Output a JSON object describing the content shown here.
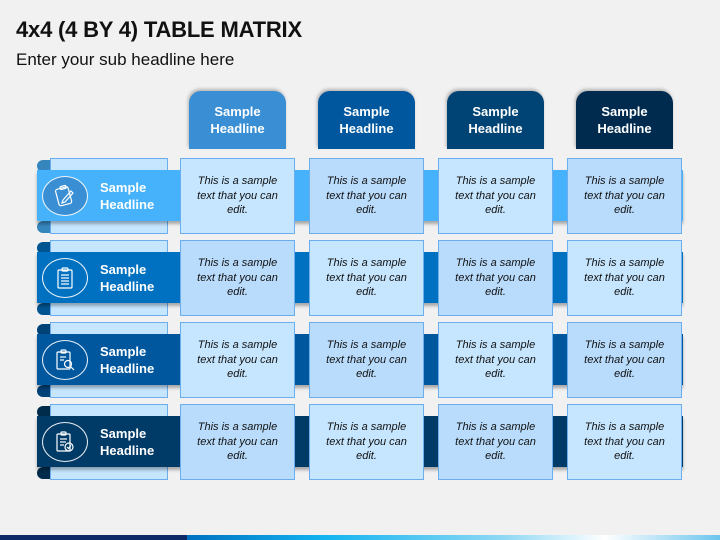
{
  "title": "4x4 (4 BY 4) TABLE MATRIX",
  "subtitle": "Enter your sub headline here",
  "colors": {
    "col_headers": [
      "#3a8fd4",
      "#00579e",
      "#004475",
      "#002b4f"
    ],
    "rows": [
      "#46b2fb",
      "#0070c0",
      "#00579e",
      "#003a66"
    ],
    "cell_light": "#c6e6ff",
    "cell_alt": "#b9dcfc",
    "cell_border": "#6aaef0"
  },
  "columns": [
    {
      "label": "Sample Headline"
    },
    {
      "label": "Sample Headline"
    },
    {
      "label": "Sample Headline"
    },
    {
      "label": "Sample Headline"
    }
  ],
  "rows": [
    {
      "label": "Sample Headline",
      "icon": "clipboard-edit-icon",
      "cells": [
        "This is a sample text that you can edit.",
        "This is a sample text that you can edit.",
        "This is a sample text that you can edit.",
        "This is a sample text that you can edit."
      ]
    },
    {
      "label": "Sample Headline",
      "icon": "clipboard-list-icon",
      "cells": [
        "This is a sample text that you can edit.",
        "This is a sample text that you can edit.",
        "This is a sample text that you can edit.",
        "This is a sample text that you can edit."
      ]
    },
    {
      "label": "Sample Headline",
      "icon": "clipboard-search-icon",
      "cells": [
        "This is a sample text that you can edit.",
        "This is a sample text that you can edit.",
        "This is a sample text that you can edit.",
        "This is a sample text that you can edit."
      ]
    },
    {
      "label": "Sample Headline",
      "icon": "clipboard-check-icon",
      "cells": [
        "This is a sample text that you can edit.",
        "This is a sample text that you can edit.",
        "This is a sample text that you can edit.",
        "This is a sample text that you can edit."
      ]
    }
  ]
}
